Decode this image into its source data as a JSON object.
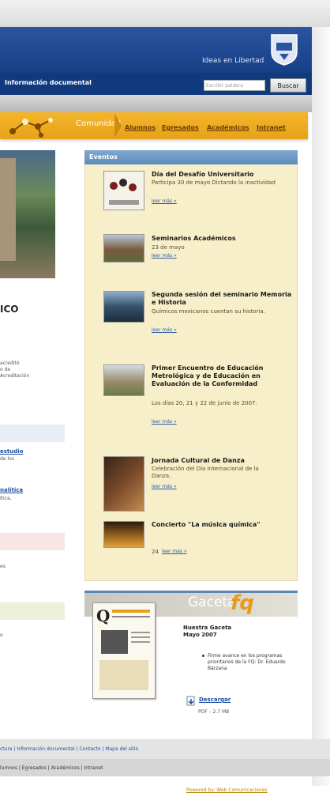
{
  "header": {
    "logo_text": "Ideas en Libertad",
    "nav_text": "Información documental",
    "search_placeholder": "Escribir palabra",
    "search_button": "Buscar"
  },
  "tabs": {
    "community": "Comunidad",
    "items": [
      "Alumnos",
      "Egresados",
      "Académicos",
      "Intranet"
    ]
  },
  "left": {
    "heading": "ICO",
    "para": [
      "acreditó",
      "o de",
      "Acreditación"
    ],
    "link1": "estudio",
    "link1_sub": "de los",
    "link2": "nalítica",
    "link2_sub": "ítica,",
    "text3": "es",
    "text4": "o"
  },
  "events": {
    "header": "Eventos",
    "items": [
      {
        "title": "Día del Desafío Universitario",
        "desc": "Participa 30 de mayo Dictando la inactividad",
        "more": "leer más »"
      },
      {
        "title": "Seminarios Académicos",
        "desc": "23 de mayo",
        "more": "leer más »"
      },
      {
        "title": "Segunda sesión del seminario Memoria e Historia",
        "desc": "Químicos mexicanos cuentan su historia.",
        "more": "leer más »"
      },
      {
        "title": "Primer Encuentro de Educación Metrológica y de Educación en Evaluación de la Conformidad",
        "desc": "Los días 20, 21 y 22 de junio de 2007.",
        "more": "leer más »"
      },
      {
        "title": "Jornada Cultural de Danza",
        "desc": "Celebración del Día Internacional de la Danza.",
        "more": "leer más »"
      },
      {
        "title": "Concierto \"La música química\"",
        "desc": "",
        "more": "leer más »"
      }
    ],
    "count_prefix": "24"
  },
  "gaceta": {
    "word": "Gaceta",
    "fq": "fq",
    "title": "Nuestra Gaceta Mayo 2007",
    "bullet": "Firme avance en los programas prioritarios de la FQ: Dr. Eduardo Bárzana",
    "download": "Descargar",
    "file": "PDF – 2.7 MB"
  },
  "footer": {
    "links1": "ctura | Información documental | Contacto | Mapa del sitio",
    "links2": "lumnos | Egresados | Académicos | Intranet",
    "powered": "Powered by: Web Comunicaciones"
  },
  "colors": {
    "accent_blue": "#173f86",
    "orange": "#e6a21a",
    "events_bg": "#f7efc9"
  }
}
